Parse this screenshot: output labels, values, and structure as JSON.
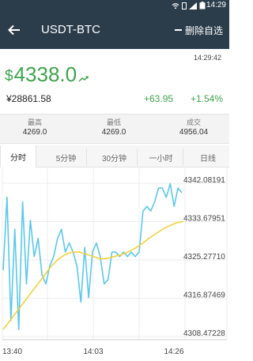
{
  "status_bar": {
    "time": "14:29"
  },
  "header": {
    "title": "USDT-BTC",
    "remove_favorite_label": "删除自选"
  },
  "price_panel": {
    "update_time": "14:29:42",
    "currency_sign": "$",
    "last_price": "4338.0",
    "cny_price": "¥28861.58",
    "change_abs": "+63.95",
    "change_pct": "+1.54%",
    "up_color": "#3fa34d"
  },
  "stats": [
    {
      "label": "最高",
      "value": "4269.0"
    },
    {
      "label": "最低",
      "value": "4269.0"
    },
    {
      "label": "成交",
      "value": "4956.04"
    }
  ],
  "tabs": [
    {
      "label": "分时",
      "active": true
    },
    {
      "label": "5分钟",
      "active": false
    },
    {
      "label": "30分钟",
      "active": false
    },
    {
      "label": "一小时",
      "active": false
    },
    {
      "label": "日线",
      "active": false
    }
  ],
  "chart_data": {
    "type": "line",
    "title": "",
    "xlabel": "",
    "ylabel": "",
    "x_tick_labels": [
      "13:40",
      "14:03",
      "14:26"
    ],
    "y_tick_labels": [
      "4342.08191",
      "4333.67951",
      "4325.27710",
      "4316.87469",
      "4308.47228"
    ],
    "ylim": [
      4308.47228,
      4342.08191
    ],
    "grid": true,
    "series": [
      {
        "color": "#5bc8ea",
        "values": [
          4323.0,
          4339.0,
          4312.0,
          4332.0,
          4310.0,
          4338.0,
          4320.0,
          4334.0,
          4326.0,
          4330.0,
          4322.0,
          4320.0,
          4324.0,
          4326.0,
          4330.0,
          4332.0,
          4327.0,
          4329.0,
          4327.0,
          4324.0,
          4316.0,
          4328.0,
          4317.0,
          4327.0,
          4329.0,
          4326.0,
          4320.0,
          4321.0,
          4327.0,
          4327.0,
          4326.0,
          4327.0,
          4326.0,
          4327.0,
          4326.0,
          4327.0,
          4336.0,
          4337.0,
          4336.0,
          4338.0,
          4341.0,
          4341.0,
          4339.0,
          4342.0,
          4337.0,
          4341.0,
          4340.0
        ]
      },
      {
        "color": "#f2d13a",
        "values": [
          4310.0,
          4312.0,
          4314.0,
          4316.0,
          4318.0,
          4320.0,
          4322.0,
          4324.0,
          4325.5,
          4326.5,
          4327.0,
          4327.0,
          4326.5,
          4326.0,
          4325.5,
          4325.6,
          4326.0,
          4326.4,
          4327.0,
          4327.8,
          4328.8,
          4330.0,
          4331.0,
          4332.0,
          4332.8,
          4333.4,
          4333.7
        ]
      }
    ]
  }
}
